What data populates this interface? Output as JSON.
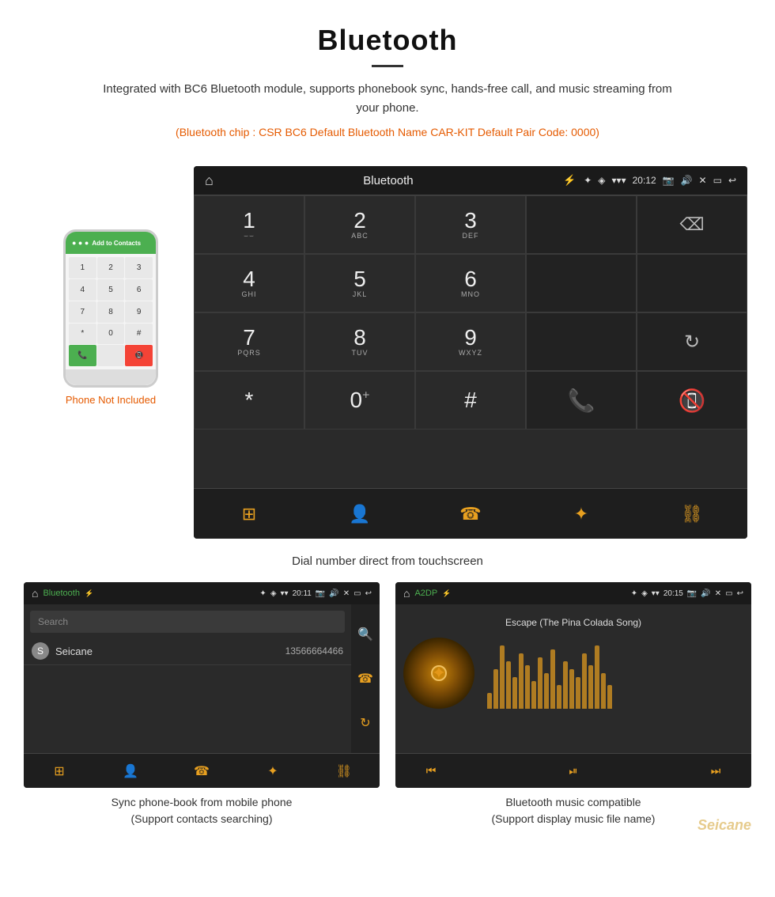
{
  "header": {
    "title": "Bluetooth",
    "description": "Integrated with BC6 Bluetooth module, supports phonebook sync, hands-free call, and music streaming from your phone.",
    "specs": "(Bluetooth chip : CSR BC6    Default Bluetooth Name CAR-KIT     Default Pair Code: 0000)"
  },
  "phone_aside": {
    "not_included": "Phone Not Included"
  },
  "dial_screen": {
    "status_bar": {
      "title": "Bluetooth",
      "time": "20:12"
    },
    "keys": [
      {
        "num": "1",
        "sub": "⌣⌣"
      },
      {
        "num": "2",
        "sub": "ABC"
      },
      {
        "num": "3",
        "sub": "DEF"
      },
      {
        "num": "",
        "sub": ""
      },
      {
        "num": "⌫",
        "sub": ""
      },
      {
        "num": "4",
        "sub": "GHI"
      },
      {
        "num": "5",
        "sub": "JKL"
      },
      {
        "num": "6",
        "sub": "MNO"
      },
      {
        "num": "",
        "sub": ""
      },
      {
        "num": "",
        "sub": ""
      },
      {
        "num": "7",
        "sub": "PQRS"
      },
      {
        "num": "8",
        "sub": "TUV"
      },
      {
        "num": "9",
        "sub": "WXYZ"
      },
      {
        "num": "",
        "sub": ""
      },
      {
        "num": "↺",
        "sub": ""
      },
      {
        "num": "*",
        "sub": ""
      },
      {
        "num": "0",
        "sub": "+"
      },
      {
        "num": "#",
        "sub": ""
      },
      {
        "num": "📞green",
        "sub": ""
      },
      {
        "num": "📞red",
        "sub": ""
      }
    ]
  },
  "dial_caption": "Dial number direct from touchscreen",
  "phonebook_screen": {
    "status_bar": {
      "title": "Bluetooth",
      "time": "20:11"
    },
    "search_placeholder": "Search",
    "contacts": [
      {
        "letter": "S",
        "name": "Seicane",
        "phone": "13566664466"
      }
    ],
    "right_icons": [
      "search",
      "phone",
      "refresh"
    ]
  },
  "music_screen": {
    "status_bar": {
      "title": "A2DP",
      "time": "20:15"
    },
    "song_title": "Escape (The Pina Colada Song)",
    "eq_bars": [
      20,
      50,
      80,
      60,
      40,
      70,
      55,
      35,
      65,
      45,
      75,
      30,
      60,
      50,
      40,
      70,
      55,
      80,
      45,
      30
    ]
  },
  "bottom_captions": {
    "left": "Sync phone-book from mobile phone\n(Support contacts searching)",
    "right": "Bluetooth music compatible\n(Support display music file name)"
  },
  "watermark": "Seicane",
  "bottom_nav_icons": [
    "grid",
    "person",
    "phone",
    "bluetooth",
    "link"
  ]
}
